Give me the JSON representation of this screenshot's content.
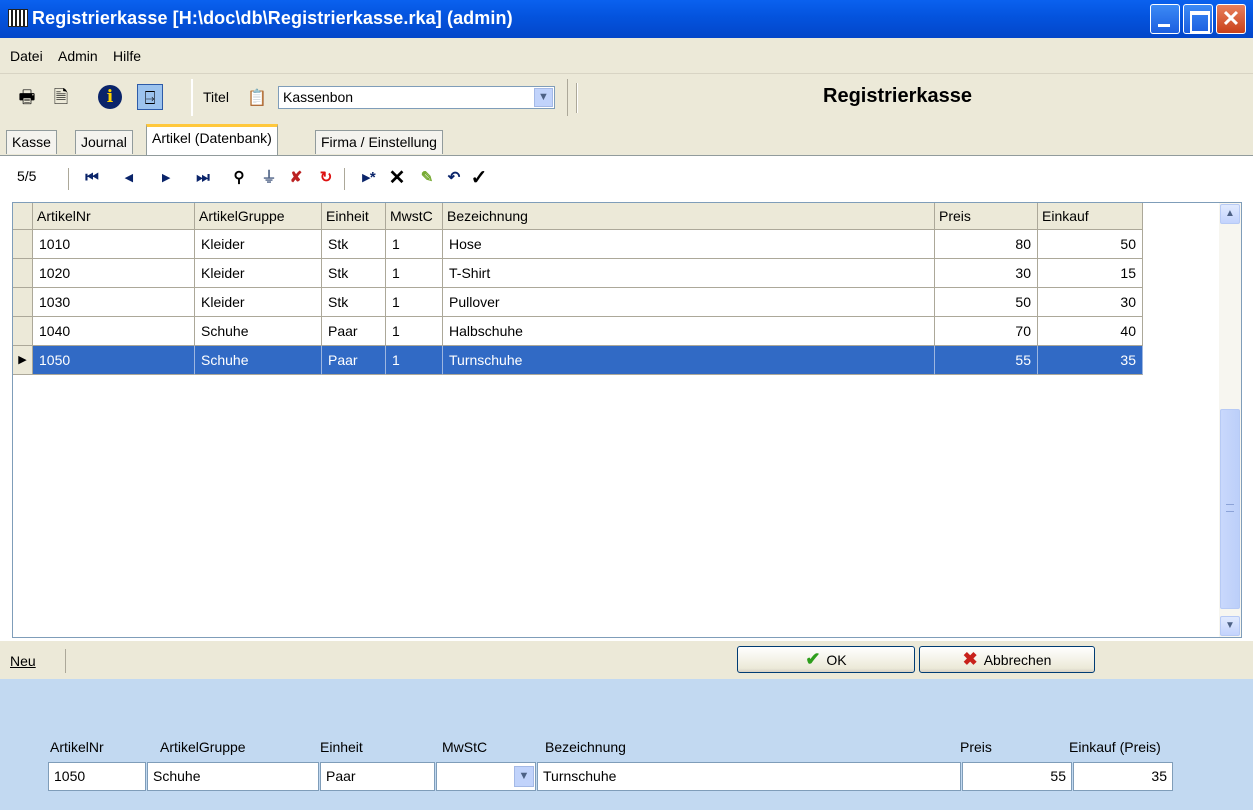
{
  "window": {
    "title": "Registrierkasse [H:\\doc\\db\\Registrierkasse.rka] (admin)",
    "close_glyph": "✕"
  },
  "menubar": {
    "items": [
      "Datei",
      "Admin",
      "Hilfe"
    ]
  },
  "toolbar": {
    "icons": [
      "printer-icon",
      "document-icon",
      "info-icon",
      "exit-door-icon"
    ],
    "title_label": "Titel",
    "title_value": "Kassenbon",
    "heading": "Registrierkasse"
  },
  "tabs": [
    {
      "label": "Kasse",
      "active": false
    },
    {
      "label": "Journal",
      "active": false
    },
    {
      "label": "Artikel (Datenbank)",
      "active": true
    },
    {
      "label": "Firma / Einstellung",
      "active": false
    }
  ],
  "navigator": {
    "record_count": "5/5",
    "buttons": [
      "first-record-icon",
      "prev-record-icon",
      "next-record-icon",
      "last-record-icon",
      "find-icon",
      "filter-icon",
      "clear-filter-icon",
      "refresh-icon",
      "insert-record-icon",
      "delete-record-icon",
      "edit-record-icon",
      "undo-icon",
      "post-icon"
    ]
  },
  "grid": {
    "columns": [
      "ArtikelNr",
      "ArtikelGruppe",
      "Einheit",
      "MwstC",
      "Bezeichnung",
      "Preis",
      "Einkauf"
    ],
    "rows": [
      [
        "1010",
        "Kleider",
        "Stk",
        "1",
        "Hose",
        "80",
        "50"
      ],
      [
        "1020",
        "Kleider",
        "Stk",
        "1",
        "T-Shirt",
        "30",
        "15"
      ],
      [
        "1030",
        "Kleider",
        "Stk",
        "1",
        "Pullover",
        "50",
        "30"
      ],
      [
        "1040",
        "Schuhe",
        "Paar",
        "1",
        "Halbschuhe",
        "70",
        "40"
      ],
      [
        "1050",
        "Schuhe",
        "Paar",
        "1",
        "Turnschuhe",
        "55",
        "35"
      ]
    ],
    "selected_row": 4,
    "selection_color": "#316ac5"
  },
  "bottombar": {
    "new_label": "Neu",
    "ok_label": "OK",
    "cancel_label": "Abbrechen"
  },
  "editor": {
    "labels": {
      "artikelnr": "ArtikelNr",
      "gruppe": "ArtikelGruppe",
      "einheit": "Einheit",
      "mwst": "MwStC",
      "bezeichnung": "Bezeichnung",
      "preis": "Preis",
      "einkauf": "Einkauf (Preis)"
    },
    "values": {
      "artikelnr": "1050",
      "gruppe": "Schuhe",
      "einheit": "Paar",
      "mwst": "",
      "bezeichnung": "Turnschuhe",
      "preis": "55",
      "einkauf": "35"
    }
  },
  "colors": {
    "titlebar": "#0453dd",
    "panel": "#c2d9f1",
    "chrome": "#ece9d8"
  }
}
